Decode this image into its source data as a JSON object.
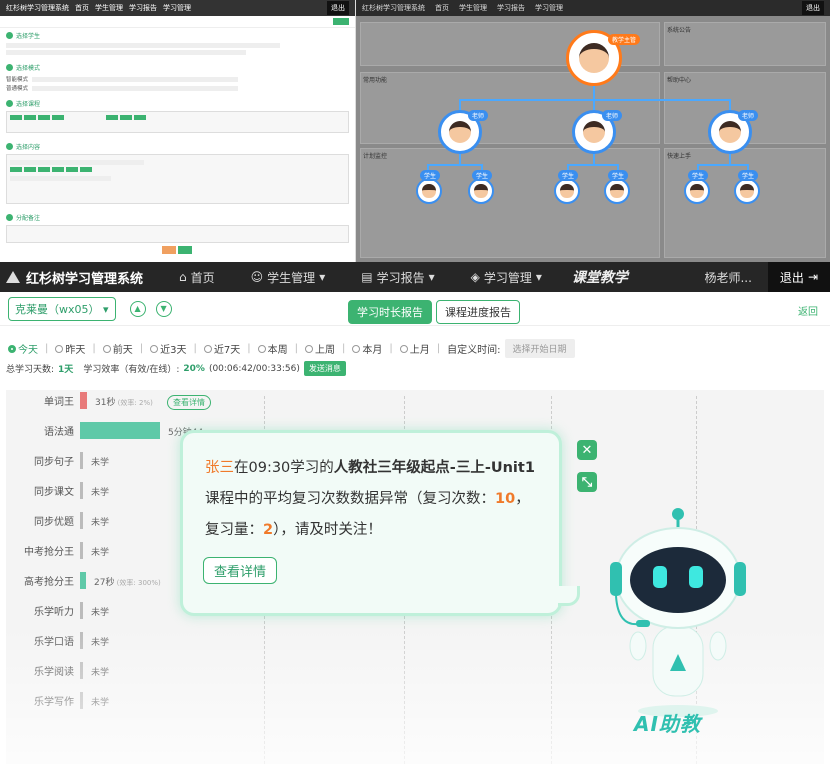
{
  "top_left": {
    "app_title": "红杉树学习管理系统",
    "nav": [
      "首页",
      "学生管理",
      "学习报告",
      "学习管理"
    ],
    "exit": "退出",
    "sections": [
      "选择学生",
      "选择模式",
      "选择课程",
      "选择内容",
      "分配备注"
    ],
    "mode_labels": [
      "智能模式",
      "普通模式"
    ]
  },
  "top_right": {
    "app_title": "红杉树学习管理系统",
    "nav": [
      "首页",
      "学生管理",
      "学习报告",
      "学习管理"
    ],
    "exit": "退出",
    "supervisor_tag": "教学主管",
    "teacher_tag": "老师",
    "student_tag": "学生",
    "panels": [
      "常用功能",
      "计划监控",
      "系统公告",
      "帮助中心",
      "快速上手"
    ]
  },
  "header": {
    "app_title": "红杉树学习管理系统",
    "nav": [
      {
        "label": "首页",
        "icon": "home-icon"
      },
      {
        "label": "学生管理",
        "icon": "users-icon"
      },
      {
        "label": "学习报告",
        "icon": "report-icon"
      },
      {
        "label": "学习管理",
        "icon": "layers-icon"
      }
    ],
    "brand": "课堂教学",
    "user": "杨老师...",
    "exit_label": "退出"
  },
  "subbar": {
    "student_select": "克莱曼（wx05）",
    "tabs": [
      "学习时长报告",
      "课程进度报告"
    ],
    "active_tab": "学习时长报告",
    "back": "返回"
  },
  "filters": {
    "options": [
      "今天",
      "昨天",
      "前天",
      "近3天",
      "近7天",
      "本周",
      "上周",
      "本月",
      "上月"
    ],
    "selected": "今天",
    "custom_label": "自定义时间:",
    "date_placeholder": "选择开始日期"
  },
  "stats": {
    "days_label": "总学习天数:",
    "days_value": "1天",
    "efficiency_label": "学习效率（有效/在线）:",
    "efficiency_value": "20%",
    "time_value": "(00:06:42/00:33:56)",
    "send_label": "发送消息"
  },
  "chart_data": {
    "type": "bar",
    "categories": [
      "单词王",
      "语法通",
      "同步句子",
      "同步课文",
      "同步优题",
      "中考抢分王",
      "高考抢分王",
      "乐学听力",
      "乐学口语",
      "乐学阅读",
      "乐学写作"
    ],
    "labels": [
      "31秒",
      "5分钟44",
      "未学",
      "未学",
      "未学",
      "未学",
      "27秒",
      "未学",
      "未学",
      "未学",
      "未学"
    ],
    "values_seconds": [
      31,
      344,
      0,
      0,
      0,
      0,
      27,
      0,
      0,
      0,
      0
    ],
    "efficiency": [
      "(效率: 2%)",
      "",
      "",
      "",
      "",
      "",
      "(效率: 300%)",
      "",
      "",
      "",
      ""
    ],
    "colors": [
      "#e87a7a",
      "#5fc9a8",
      "#bbb",
      "#bbb",
      "#bbb",
      "#bbb",
      "#5fc9a8",
      "#bbb",
      "#bbb",
      "#bbb",
      "#bbb"
    ],
    "detail_label": "查看详情"
  },
  "alert": {
    "name": "张三",
    "time_text": "在09:30学习的",
    "course": "人教社三年级起点-三上-Unit1",
    "line2a": "课程中的平均复习次数数据异常（复习次数：",
    "count": "10",
    "line2b": "，",
    "line3a": "复习量：",
    "amount": "2",
    "line3b": "），请及时关注！",
    "button": "查看详情"
  },
  "assistant": {
    "label": "AI助教"
  }
}
